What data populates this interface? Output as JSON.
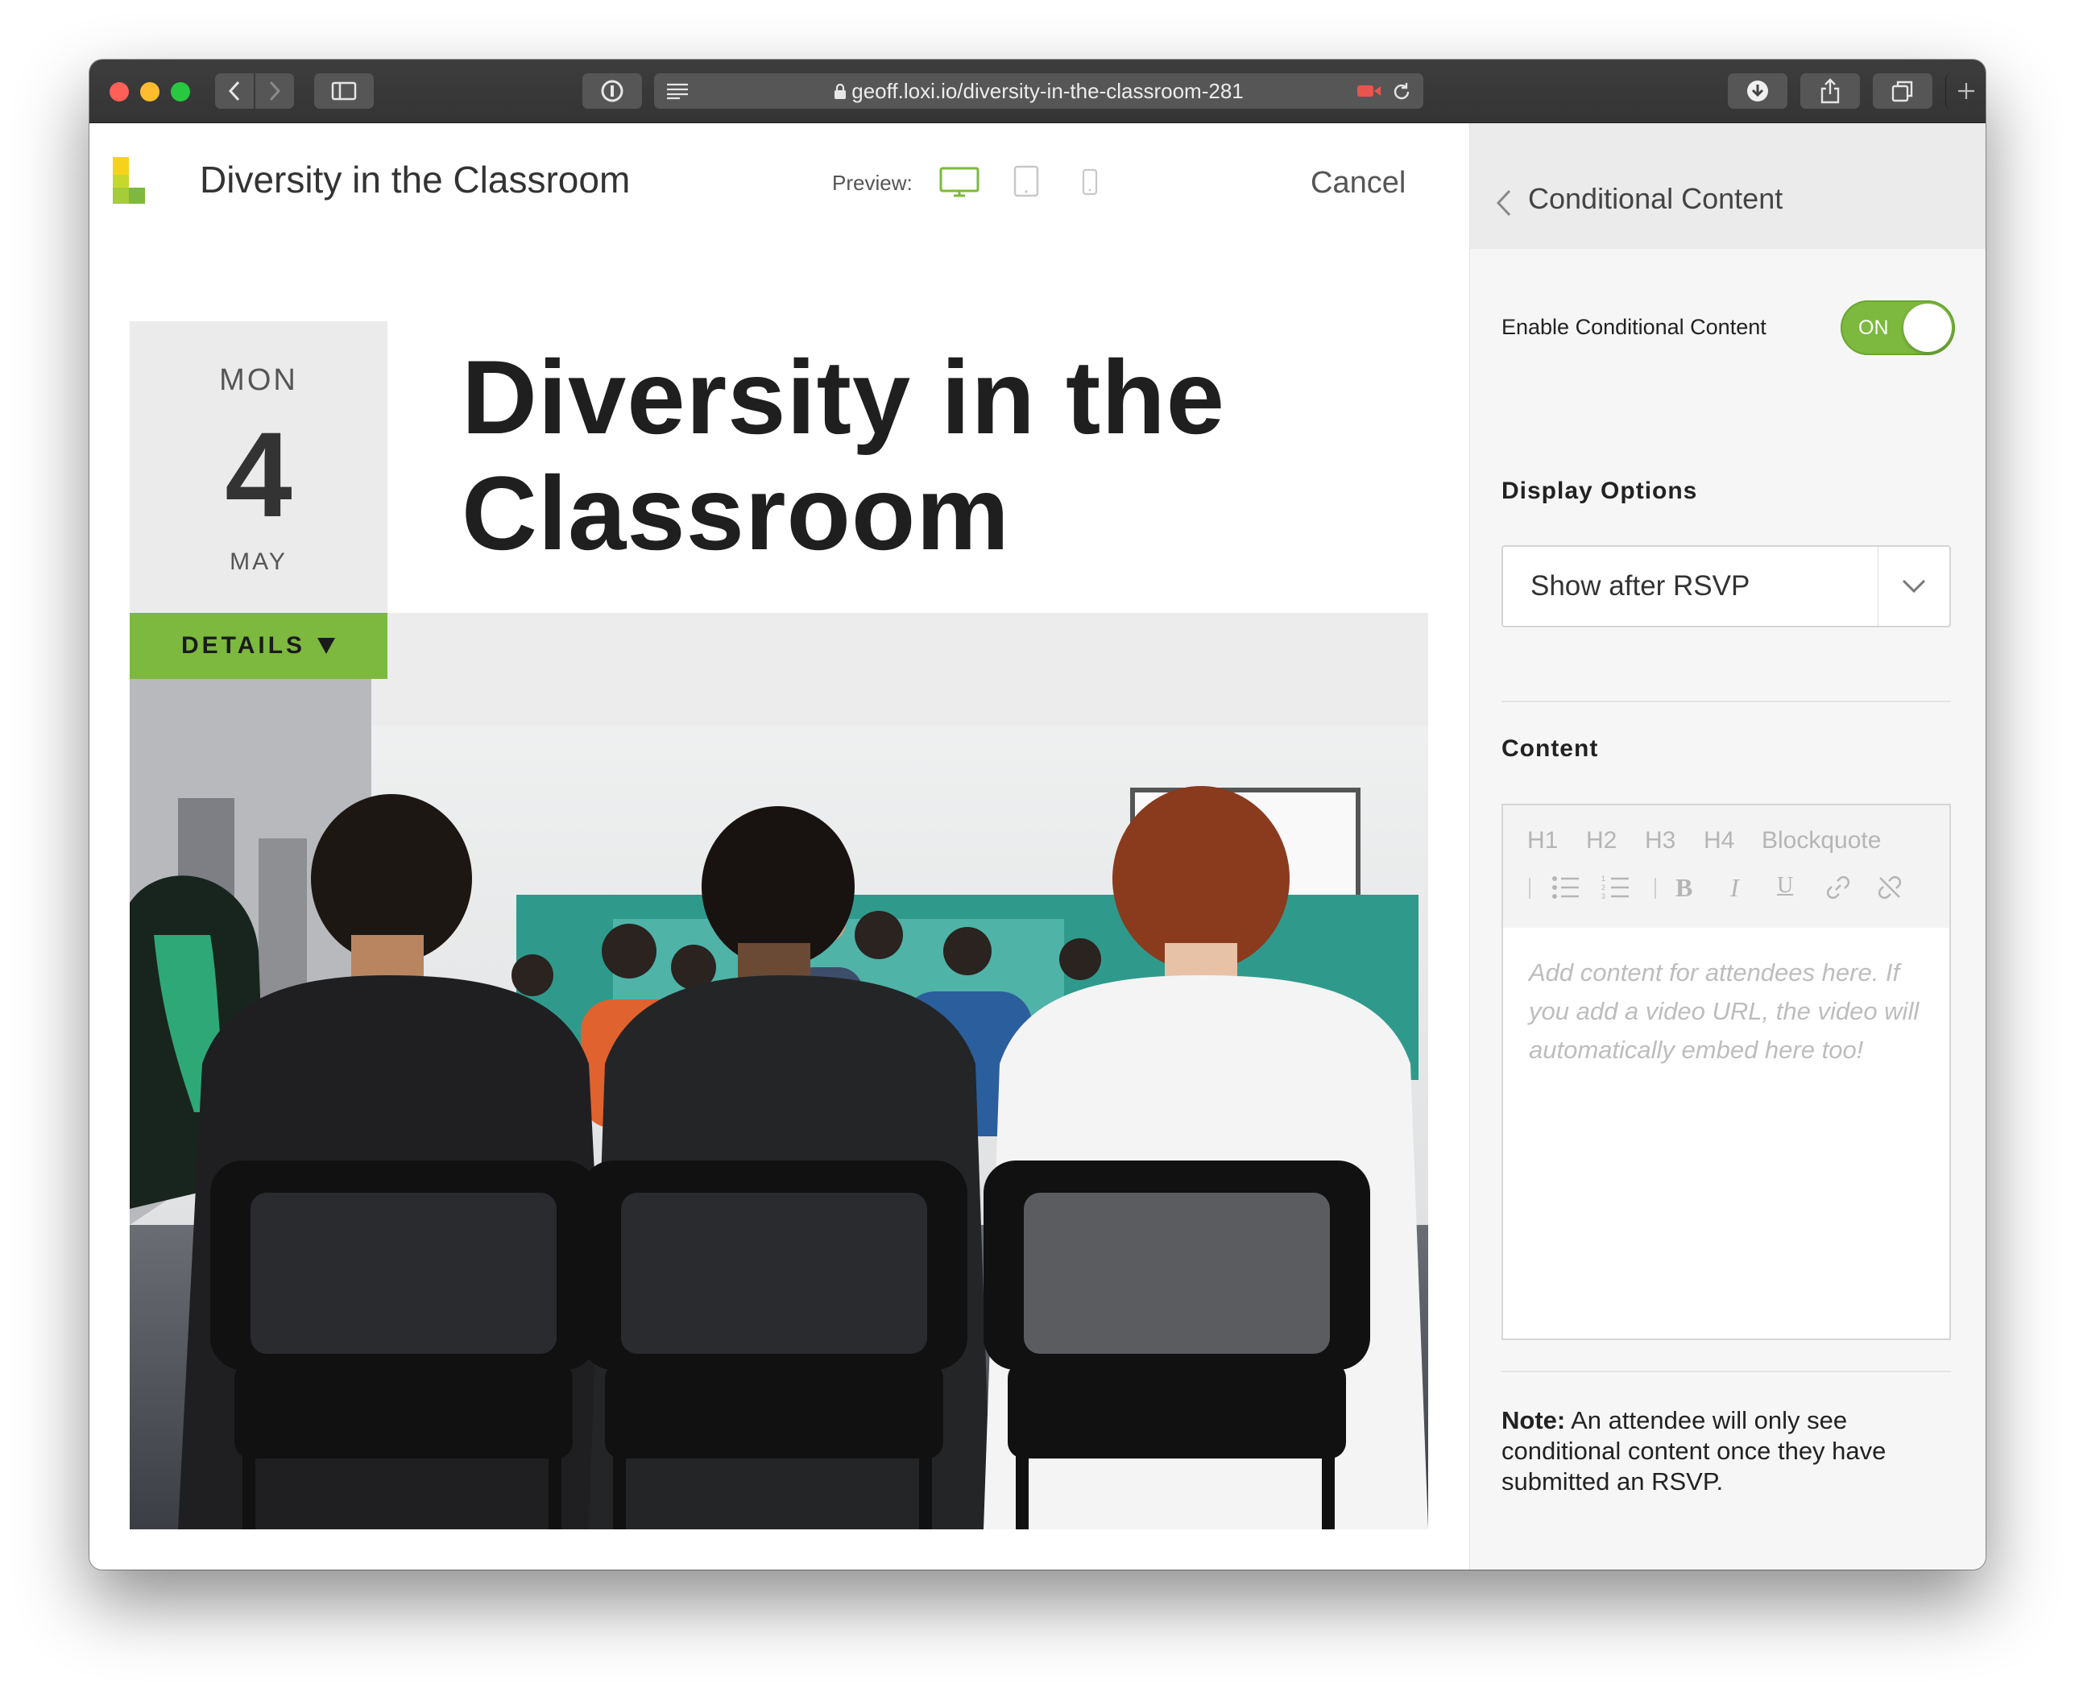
{
  "browser": {
    "url": "geoff.loxi.io/diversity-in-the-classroom-281"
  },
  "header": {
    "title": "Diversity in the Classroom",
    "preview_label": "Preview:",
    "cancel_label": "Cancel"
  },
  "event": {
    "weekday": "MON",
    "day": "4",
    "month": "MAY",
    "details_label": "DETAILS",
    "title": "Diversity in the Classroom"
  },
  "panel": {
    "title": "Conditional Content",
    "toggle_label": "Enable Conditional Content",
    "toggle_state": "ON",
    "display_options_label": "Display Options",
    "display_option_value": "Show after RSVP",
    "content_label": "Content",
    "editor": {
      "headings": [
        "H1",
        "H2",
        "H3",
        "H4",
        "Blockquote"
      ],
      "placeholder": "Add content for attendees here. If you add a video URL, the video will automatically embed here too!"
    },
    "note_label": "Note:",
    "note_text": " An attendee will only see conditional content once they have submitted an RSVP."
  },
  "colors": {
    "accent": "#7cb93e",
    "toolbar": "#3a3a3a"
  }
}
